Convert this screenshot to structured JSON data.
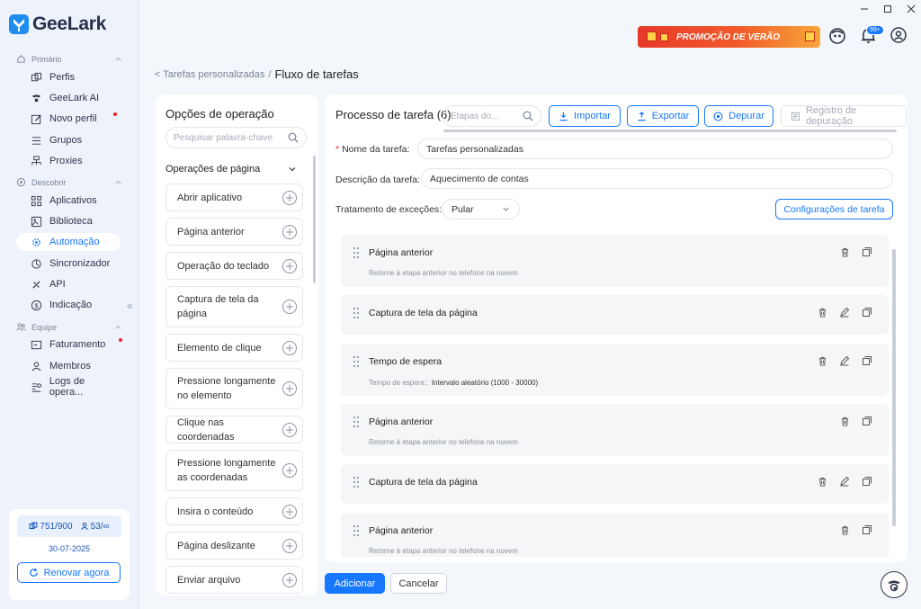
{
  "app": {
    "name": "GeeLark"
  },
  "sidebar": {
    "sections": [
      {
        "label": "Primário",
        "icon": "home-icon"
      },
      {
        "label": "Descobrir",
        "icon": "compass-icon"
      },
      {
        "label": "Equipe",
        "icon": "team-icon"
      }
    ],
    "items": [
      {
        "label": "Perfis",
        "icon": "profiles-icon"
      },
      {
        "label": "GeeLark AI",
        "icon": "ai-icon"
      },
      {
        "label": "Novo perfil",
        "icon": "edit-icon",
        "dot": true
      },
      {
        "label": "Grupos",
        "icon": "list-icon"
      },
      {
        "label": "Proxies",
        "icon": "network-icon"
      },
      {
        "label": "Aplicativos",
        "icon": "apps-icon"
      },
      {
        "label": "Biblioteca",
        "icon": "library-icon"
      },
      {
        "label": "Automação",
        "icon": "automation-icon",
        "active": true
      },
      {
        "label": "Sincronizador",
        "icon": "sync-icon"
      },
      {
        "label": "API",
        "icon": "api-icon"
      },
      {
        "label": "Indicação",
        "icon": "dollar-icon"
      },
      {
        "label": "Faturamento",
        "icon": "billing-icon",
        "dot": true
      },
      {
        "label": "Membros",
        "icon": "members-icon"
      },
      {
        "label": "Logs de opera...",
        "icon": "logs-icon"
      }
    ],
    "stats": {
      "profiles": "751/900",
      "members": "53/∞"
    },
    "date": "30-07-2025",
    "renew_label": "Renovar agora"
  },
  "topbar": {
    "promo_text": "PROMOÇÃO DE VERÃO",
    "notif_badge": "99+"
  },
  "breadcrumb": {
    "parent": "< Tarefas personalizadas",
    "separator": "/",
    "current": "Fluxo de tarefas"
  },
  "operations": {
    "title": "Opções de operação",
    "search_placeholder": "Pesquisar palavra-chave",
    "group_label": "Operações de página",
    "items": [
      "Abrir aplicativo",
      "Página anterior",
      "Operação do teclado",
      "Captura de tela da página",
      "Elemento de clique",
      "Pressione longamente no elemento",
      "Clique nas coordenadas",
      "Pressione longamente as coordenadas",
      "Insira o conteúdo",
      "Página deslizante",
      "Enviar arquivo"
    ]
  },
  "process": {
    "title": "Processo de tarefa (6)",
    "search_placeholder": "Etapas do...",
    "buttons": {
      "import": "Importar",
      "export": "Exportar",
      "debug": "Depurar",
      "debug_log": "Registro de depuração"
    },
    "fields": {
      "name_label": "Nome da tarefa:",
      "name_value": "Tarefas personalizadas",
      "desc_label": "Descrição da tarefa:",
      "desc_value": "Aquecimento de contas",
      "exc_label": "Tratamento de exceções:",
      "exc_value": "Pular"
    },
    "config_button": "Configurações de tarefa",
    "steps": [
      {
        "title": "Página anterior",
        "subtitle": "Retorne à etapa anterior no telefone na nuvem",
        "editable": false
      },
      {
        "title": "Captura de tela da página",
        "subtitle": "",
        "editable": true
      },
      {
        "title": "Tempo de espera",
        "subtitle_label": "Tempo de espera：",
        "subtitle_value": "Intervalo aleatório (1000 - 30000)",
        "editable": true
      },
      {
        "title": "Página anterior",
        "subtitle": "Retorne à etapa anterior no telefone na nuvem",
        "editable": false
      },
      {
        "title": "Captura de tela da página",
        "subtitle": "",
        "editable": true
      },
      {
        "title": "Página anterior",
        "subtitle": "Retorne à etapa anterior no telefone na nuvem",
        "editable": false
      }
    ]
  },
  "footer": {
    "add_label": "Adicionar",
    "cancel_label": "Cancelar"
  },
  "colors": {
    "accent": "#1677ff",
    "sidebar_bg": "#edf2fb",
    "promo": "#e8392a"
  }
}
